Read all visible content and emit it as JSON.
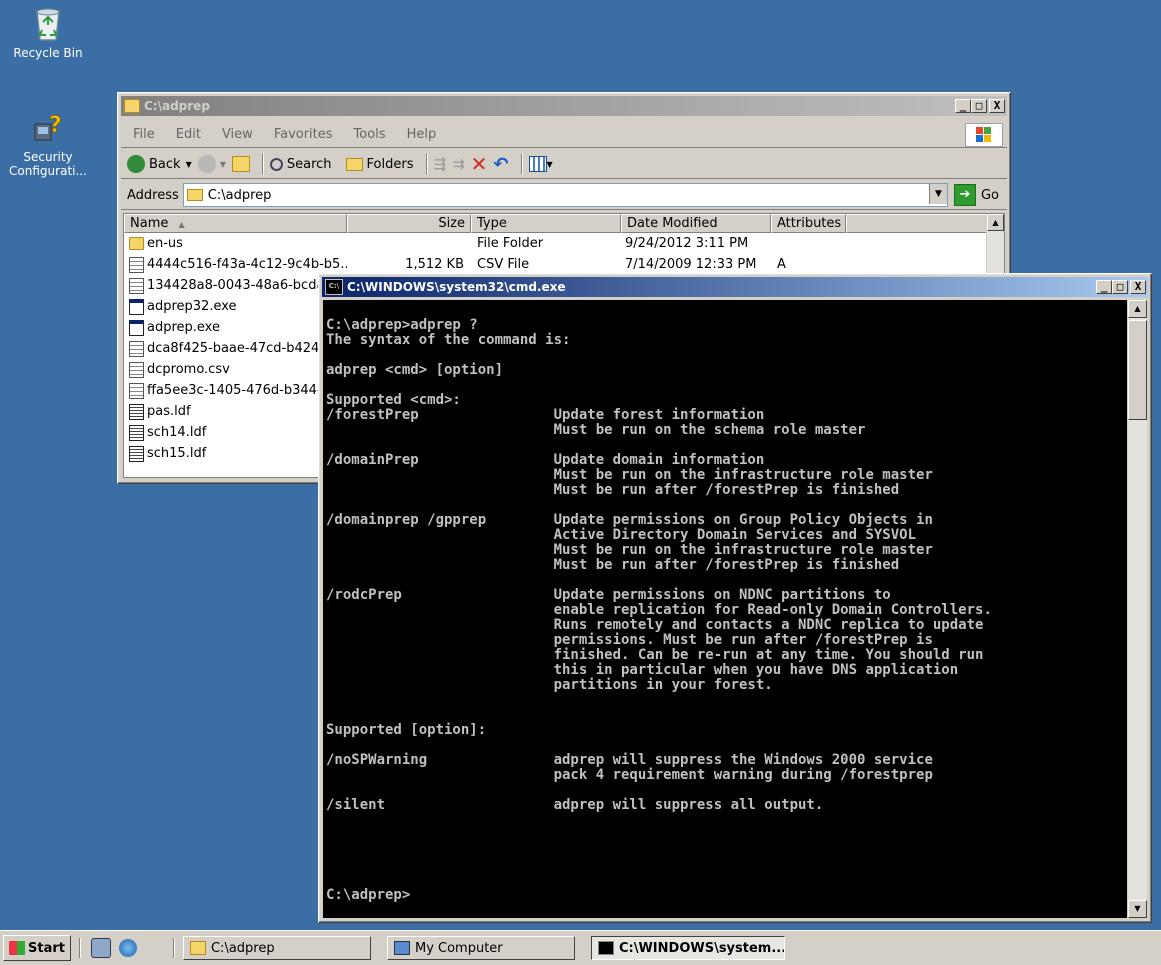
{
  "desktop": {
    "icons": [
      {
        "label": "Recycle Bin"
      },
      {
        "label": "Security Configurati..."
      }
    ]
  },
  "explorer": {
    "title": "C:\\adprep",
    "menu": [
      "File",
      "Edit",
      "View",
      "Favorites",
      "Tools",
      "Help"
    ],
    "toolbar": {
      "back": "Back",
      "search": "Search",
      "folders": "Folders"
    },
    "address_label": "Address",
    "address_value": "C:\\adprep",
    "go_label": "Go",
    "columns": [
      "Name",
      "Size",
      "Type",
      "Date Modified",
      "Attributes"
    ],
    "files": [
      {
        "name": "en-us",
        "size": "",
        "type": "File Folder",
        "date": "9/24/2012 3:11 PM",
        "attr": "",
        "icon": "folder-icon"
      },
      {
        "name": "4444c516-f43a-4c12-9c4b-b5...",
        "size": "1,512 KB",
        "type": "CSV File",
        "date": "7/14/2009 12:33 PM",
        "attr": "A",
        "icon": "csv-file-icon"
      },
      {
        "name": "134428a8-0043-48a6-bcda-",
        "size": "",
        "type": "",
        "date": "",
        "attr": "",
        "icon": "csv-file-icon"
      },
      {
        "name": "adprep32.exe",
        "size": "",
        "type": "",
        "date": "",
        "attr": "",
        "icon": "exe-file-icon"
      },
      {
        "name": "adprep.exe",
        "size": "",
        "type": "",
        "date": "",
        "attr": "",
        "icon": "exe-file-icon"
      },
      {
        "name": "dca8f425-baae-47cd-b424-e",
        "size": "",
        "type": "",
        "date": "",
        "attr": "",
        "icon": "csv-file-icon"
      },
      {
        "name": "dcpromo.csv",
        "size": "",
        "type": "",
        "date": "",
        "attr": "",
        "icon": "csv-file-icon"
      },
      {
        "name": "ffa5ee3c-1405-476d-b344-7",
        "size": "",
        "type": "",
        "date": "",
        "attr": "",
        "icon": "csv-file-icon"
      },
      {
        "name": "pas.ldf",
        "size": "",
        "type": "",
        "date": "",
        "attr": "",
        "icon": "ldf-file-icon"
      },
      {
        "name": "sch14.ldf",
        "size": "",
        "type": "",
        "date": "",
        "attr": "",
        "icon": "ldf-file-icon"
      },
      {
        "name": "sch15.ldf",
        "size": "",
        "type": "",
        "date": "",
        "attr": "",
        "icon": "ldf-file-icon"
      }
    ]
  },
  "cmd": {
    "title": "C:\\WINDOWS\\system32\\cmd.exe",
    "output": "C:\\adprep>adprep ?\nThe syntax of the command is:\n\nadprep <cmd> [option]\n\nSupported <cmd>:\n/forestPrep                Update forest information\n                           Must be run on the schema role master\n\n/domainPrep                Update domain information\n                           Must be run on the infrastructure role master\n                           Must be run after /forestPrep is finished\n\n/domainprep /gpprep        Update permissions on Group Policy Objects in\n                           Active Directory Domain Services and SYSVOL\n                           Must be run on the infrastructure role master\n                           Must be run after /forestPrep is finished\n\n/rodcPrep                  Update permissions on NDNC partitions to\n                           enable replication for Read-only Domain Controllers.\n                           Runs remotely and contacts a NDNC replica to update\n                           permissions. Must be run after /forestPrep is\n                           finished. Can be re-run at any time. You should run\n                           this in particular when you have DNS application\n                           partitions in your forest.\n\n\nSupported [option]:\n\n/noSPWarning               adprep will suppress the Windows 2000 service\n                           pack 4 requirement warning during /forestprep\n\n/silent                    adprep will suppress all output.\n\n\n\n\n\nC:\\adprep>"
  },
  "taskbar": {
    "start_label": "Start",
    "items": [
      {
        "label": "C:\\adprep",
        "active": false
      },
      {
        "label": "My Computer",
        "active": false
      },
      {
        "label": "C:\\WINDOWS\\system...",
        "active": true
      }
    ]
  },
  "window_buttons": {
    "minimize": "_",
    "maximize": "□",
    "close": "X"
  },
  "colors": {
    "desktop": "#3a6ea5",
    "active_title": "#0a246a",
    "console_bg": "#000000",
    "console_fg": "#c0c0c0"
  }
}
